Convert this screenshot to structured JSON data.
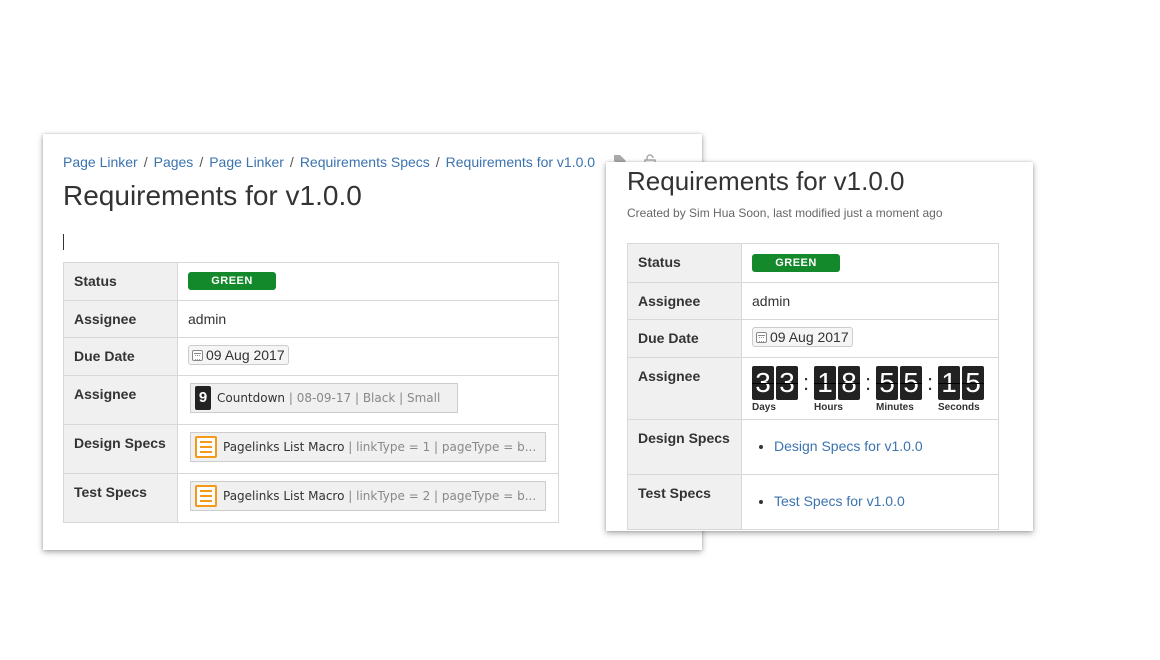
{
  "editor": {
    "breadcrumb": [
      "Page Linker",
      "Pages",
      "Page Linker",
      "Requirements Specs",
      "Requirements for v1.0.0"
    ],
    "title": "Requirements for v1.0.0",
    "rows": {
      "status": {
        "label": "Status",
        "value": "GREEN"
      },
      "assignee": {
        "label": "Assignee",
        "value": "admin"
      },
      "due_date": {
        "label": "Due Date",
        "value": "09 Aug 2017"
      },
      "countdown": {
        "label": "Assignee",
        "icon_digit": "9",
        "macro_name": "Countdown",
        "macro_params": " | 08-09-17 | Black | Small"
      },
      "design_specs": {
        "label": "Design Specs",
        "macro_name": "Pagelinks List Macro",
        "macro_params": " | linkType = 1 | pageType = b..."
      },
      "test_specs": {
        "label": "Test Specs",
        "macro_name": "Pagelinks List Macro",
        "macro_params": " | linkType = 2 | pageType = b..."
      }
    }
  },
  "view": {
    "title": "Requirements for v1.0.0",
    "byline": "Created by Sim Hua Soon, last modified just a moment ago",
    "rows": {
      "status": {
        "label": "Status",
        "value": "GREEN"
      },
      "assignee": {
        "label": "Assignee",
        "value": "admin"
      },
      "due_date": {
        "label": "Due Date",
        "value": "09 Aug 2017"
      },
      "countdown": {
        "label": "Assignee",
        "units": [
          {
            "digits": [
              "3",
              "3"
            ],
            "label": "Days"
          },
          {
            "digits": [
              "1",
              "8"
            ],
            "label": "Hours"
          },
          {
            "digits": [
              "5",
              "5"
            ],
            "label": "Minutes"
          },
          {
            "digits": [
              "1",
              "5"
            ],
            "label": "Seconds"
          }
        ],
        "separator": ":"
      },
      "design_specs": {
        "label": "Design Specs",
        "link": "Design Specs for v1.0.0"
      },
      "test_specs": {
        "label": "Test Specs",
        "link": "Test Specs for v1.0.0"
      }
    }
  },
  "colors": {
    "link": "#3b73af",
    "status_green": "#14892c",
    "macro_orange": "#f39a1d"
  }
}
